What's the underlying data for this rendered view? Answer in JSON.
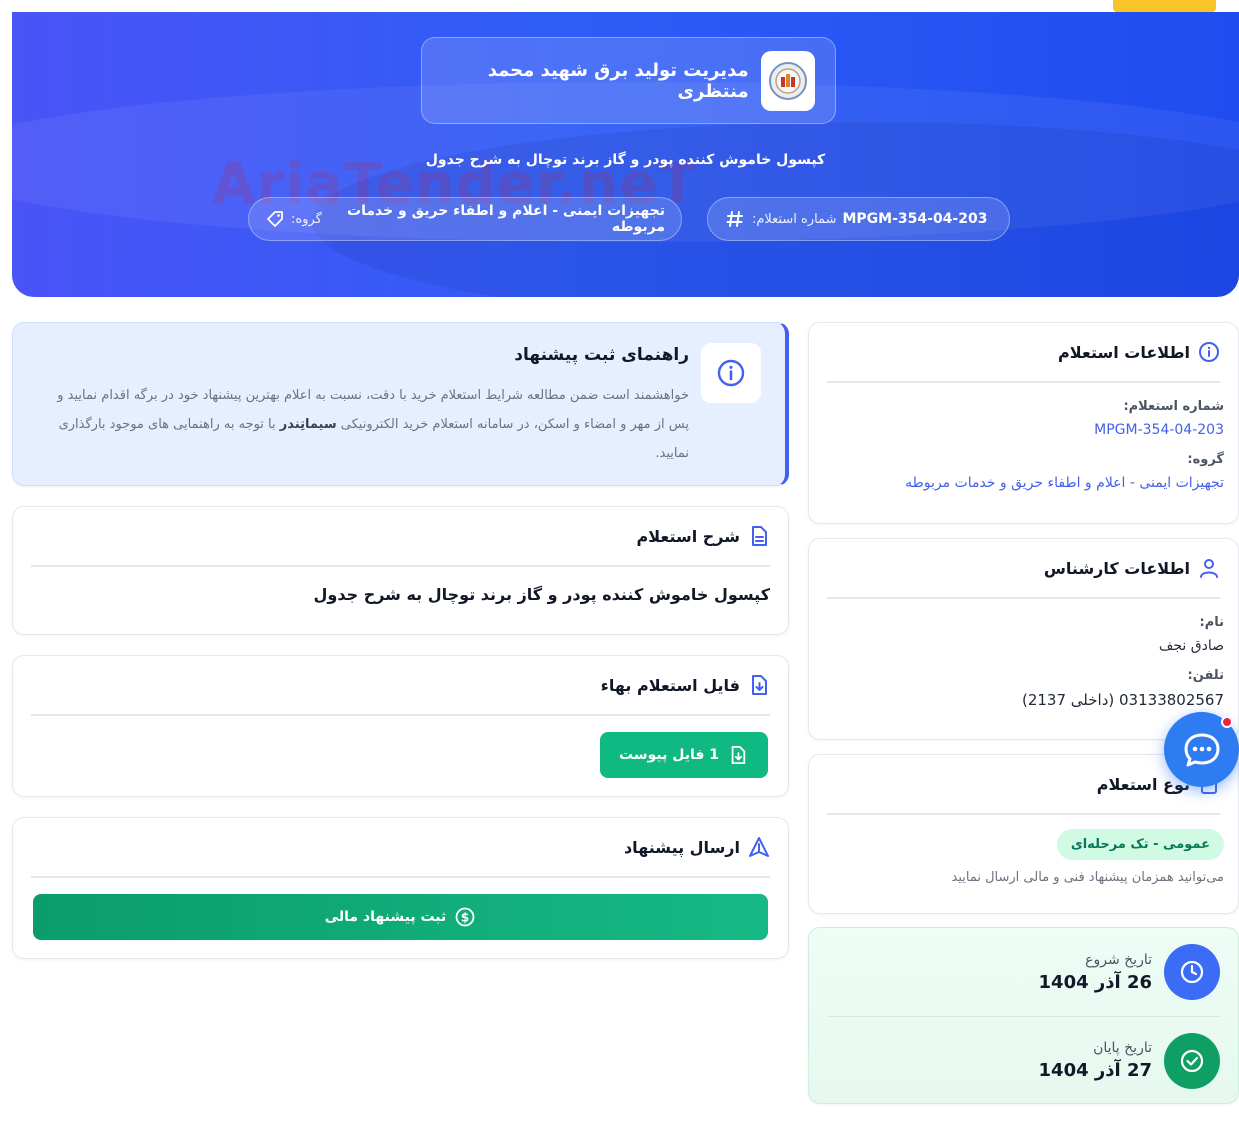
{
  "hero": {
    "org_name": "مدیریت تولید برق شهید محمد منتظری",
    "title": "کپسول خاموش کننده پودر و گاز برند توچال به شرح جدول",
    "number_label": "شماره استعلام:",
    "number_value": "MPGM-354-04-203",
    "group_label": "گروه:",
    "group_value": "تجهیزات ایمنی - اعلام و اطفاء حریق و خدمات مربوطه",
    "watermark": "AriaTender.neT"
  },
  "info": {
    "title": "اطلاعات استعلام",
    "number_label": "شماره استعلام:",
    "number_value": "MPGM-354-04-203",
    "group_label": "گروه:",
    "group_value": "تجهیزات ایمنی - اعلام و اطفاء حریق و خدمات مربوطه"
  },
  "expert": {
    "title": "اطلاعات کارشناس",
    "name_label": "نام:",
    "name_value": "صادق نجف",
    "phone_label": "تلفن:",
    "phone_value": "03133802567 (داخلی 2137)"
  },
  "type": {
    "title": "نوع استعلام",
    "badge": "عمومی - تک مرحله‌ای",
    "note": "می‌توانید همزمان پیشنهاد فنی و مالی ارسال نمایید"
  },
  "dates": {
    "start_label": "تاریخ شروع",
    "start_value": "26 آذر 1404",
    "end_label": "تاریخ پایان",
    "end_value": "27 آذر 1404"
  },
  "guide": {
    "title": "راهنمای ثبت پیشنهاد",
    "text_1": "خواهشمند است ضمن مطالعه شرایط استعلام خرید با دقت، نسبت به اعلام بهترین پیشنهاد خود در برگه اقدام نمایید و پس از مهر و امضاء و اسکن، در سامانه استعلام خرید الکترونیکی",
    "brand": "سیماتِندر",
    "text_2": "با توجه به راهنمایی های موجود بارگذاری نمایید."
  },
  "description": {
    "title": "شرح استعلام",
    "body": "کپسول خاموش کننده پودر و گاز برند توچال به شرح جدول"
  },
  "file": {
    "title": "فایل استعلام بهاء",
    "button": "1 فایل پیوست"
  },
  "send": {
    "title": "ارسال پیشنهاد",
    "button": "ثبت پیشنهاد مالی"
  },
  "colors": {
    "accent": "#4361ee",
    "green": "#10b981",
    "hero": "#2f5cf6",
    "tab": "#f8c42a"
  }
}
